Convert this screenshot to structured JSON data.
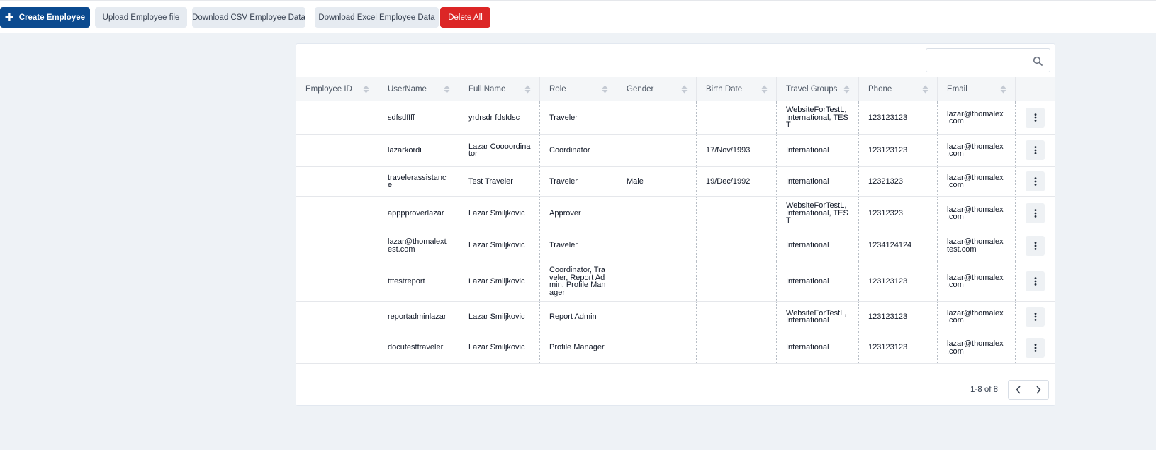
{
  "toolbar": {
    "create_label": "Create Employee",
    "upload_label": "Upload Employee file",
    "csv_label": "Download CSV Employee Data",
    "excel_label": "Download Excel Employee Data",
    "delete_label": "Delete All"
  },
  "search": {
    "placeholder": ""
  },
  "table": {
    "columns": [
      "Employee ID",
      "UserName",
      "Full Name",
      "Role",
      "Gender",
      "Birth Date",
      "Travel Groups",
      "Phone",
      "Email"
    ],
    "rows": [
      {
        "employee_id": "",
        "username": "sdfsdffff",
        "full_name": "yrdrsdr fdsfdsc",
        "role": "Traveler",
        "gender": "",
        "birth_date": "",
        "travel_groups": "WebsiteForTestL, International, TEST",
        "phone": "123123123",
        "email": "lazar@thomalex .com"
      },
      {
        "employee_id": "",
        "username": "lazarkordi",
        "full_name": "Lazar Coooordinator",
        "role": "Coordinator",
        "gender": "",
        "birth_date": "17/Nov/1993",
        "travel_groups": "International",
        "phone": "123123123",
        "email": "lazar@thomalex .com"
      },
      {
        "employee_id": "",
        "username": "travelerassistance",
        "full_name": "Test Traveler",
        "role": "Traveler",
        "gender": "Male",
        "birth_date": "19/Dec/1992",
        "travel_groups": "International",
        "phone": "12321323",
        "email": "lazar@thomalex .com"
      },
      {
        "employee_id": "",
        "username": "apppproverlazar",
        "full_name": "Lazar Smiljkovic",
        "role": "Approver",
        "gender": "",
        "birth_date": "",
        "travel_groups": "WebsiteForTestL, International, TEST",
        "phone": "12312323",
        "email": "lazar@thomalex .com"
      },
      {
        "employee_id": "",
        "username": "lazar@thomalextest.com",
        "full_name": "Lazar Smiljkovic",
        "role": "Traveler",
        "gender": "",
        "birth_date": "",
        "travel_groups": "International",
        "phone": "1234124124",
        "email": "lazar@thomalex test.com"
      },
      {
        "employee_id": "",
        "username": "tttestreport",
        "full_name": "Lazar Smiljkovic",
        "role": "Coordinator, Traveler, Report Admin, Profile Manager",
        "gender": "",
        "birth_date": "",
        "travel_groups": "International",
        "phone": "123123123",
        "email": "lazar@thomalex .com"
      },
      {
        "employee_id": "",
        "username": "reportadminlazar",
        "full_name": "Lazar Smiljkovic",
        "role": "Report Admin",
        "gender": "",
        "birth_date": "",
        "travel_groups": "WebsiteForTestL, International",
        "phone": "123123123",
        "email": "lazar@thomalex .com"
      },
      {
        "employee_id": "",
        "username": "docutesttraveler",
        "full_name": "Lazar Smiljkovic",
        "role": "Profile Manager",
        "gender": "",
        "birth_date": "",
        "travel_groups": "International",
        "phone": "123123123",
        "email": "lazar@thomalex .com"
      }
    ]
  },
  "pagination": {
    "range_text": "1-8 of 8"
  },
  "colors": {
    "primary": "#0b4a8f",
    "danger": "#dc2626",
    "light_button": "#e6ebf1",
    "page_bg": "#eef2f6"
  },
  "icons": {
    "create": "plus-icon",
    "search": "search-icon",
    "sort": "sort-icon",
    "row_menu": "kebab-menu-icon",
    "prev": "chevron-left-icon",
    "next": "chevron-right-icon"
  }
}
